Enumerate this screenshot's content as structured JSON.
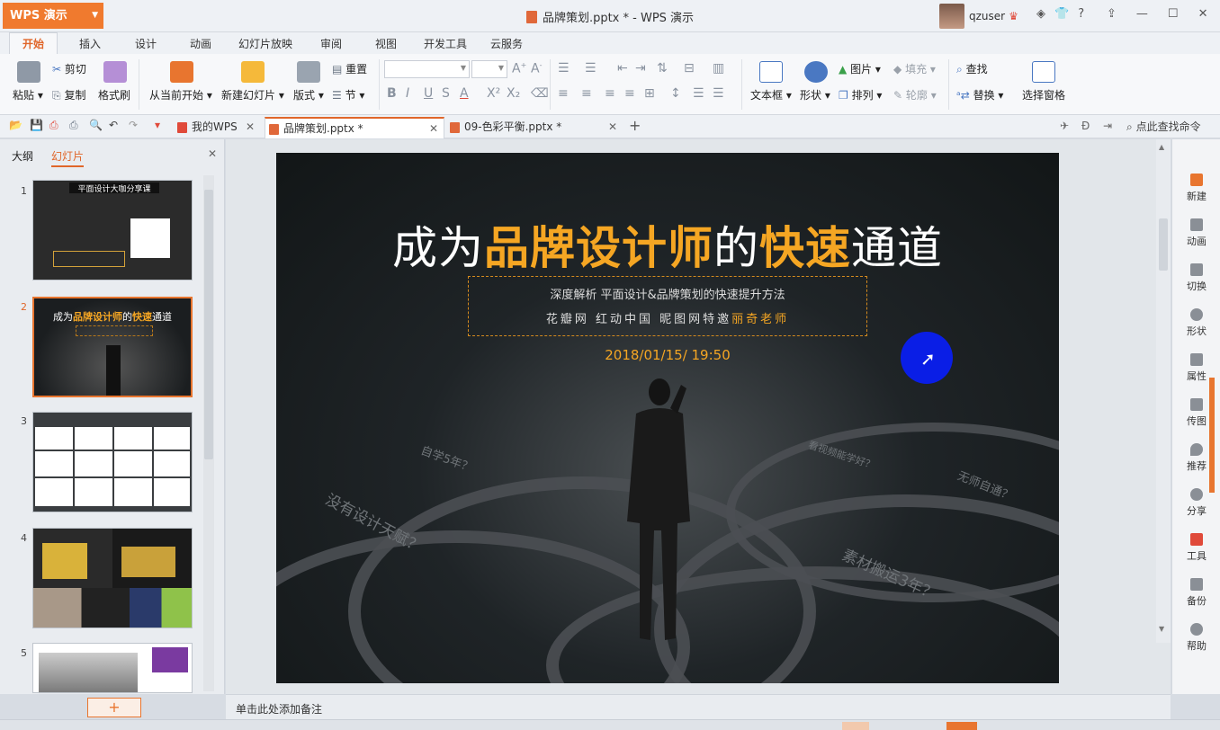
{
  "window": {
    "app_name": "WPS 演示",
    "title": "品牌策划.pptx * - WPS 演示",
    "username": "qzuser"
  },
  "ribbon_tabs": [
    "开始",
    "插入",
    "设计",
    "动画",
    "幻灯片放映",
    "审阅",
    "视图",
    "开发工具",
    "云服务"
  ],
  "ribbon": {
    "paste": "粘贴",
    "cut": "剪切",
    "copy": "复制",
    "format_painter": "格式刷",
    "from_current": "从当前开始",
    "new_slide": "新建幻灯片",
    "layout": "版式",
    "reset": "重置",
    "section": "节",
    "textbox": "文本框",
    "shape": "形状",
    "picture": "图片",
    "fill": "填充",
    "arrange": "排列",
    "outline": "轮廓",
    "find": "查找",
    "replace": "替换",
    "selection_pane": "选择窗格"
  },
  "doc_tabs": [
    {
      "label": "我的WPS"
    },
    {
      "label": "品牌策划.pptx *"
    },
    {
      "label": "09-色彩平衡.pptx *"
    }
  ],
  "search_command": "点此查找命令",
  "left_panel": {
    "tab_outline": "大纲",
    "tab_slides": "幻灯片",
    "slide_numbers": [
      "1",
      "2",
      "3",
      "4",
      "5"
    ],
    "thumb1_title": "平面设计大咖分享课",
    "thumb2_title_a": "成为",
    "thumb2_title_b": "品牌设计师",
    "thumb2_title_c": "的",
    "thumb2_title_d": "快速",
    "thumb2_title_e": "通道"
  },
  "slide": {
    "title_a": "成为",
    "title_b": "品牌设计师",
    "title_c": "的",
    "title_d": "快速",
    "title_e": "通道",
    "subtitle1": "深度解析 平面设计&品牌策划的快速提升方法",
    "subtitle2_a": "花瓣网 红动中国 昵图网特邀",
    "subtitle2_b": "丽奇老师",
    "datetime": "2018/01/15/    19:50",
    "road_texts": [
      "自学5年？",
      "没有设计天赋？",
      "看视频能学好？",
      "无师自通？",
      "素材搬运3年？"
    ]
  },
  "right_bar": [
    "新建",
    "动画",
    "切换",
    "形状",
    "属性",
    "传图",
    "推荐",
    "分享",
    "工具",
    "备份",
    "帮助"
  ],
  "notes_placeholder": "单击此处添加备注"
}
